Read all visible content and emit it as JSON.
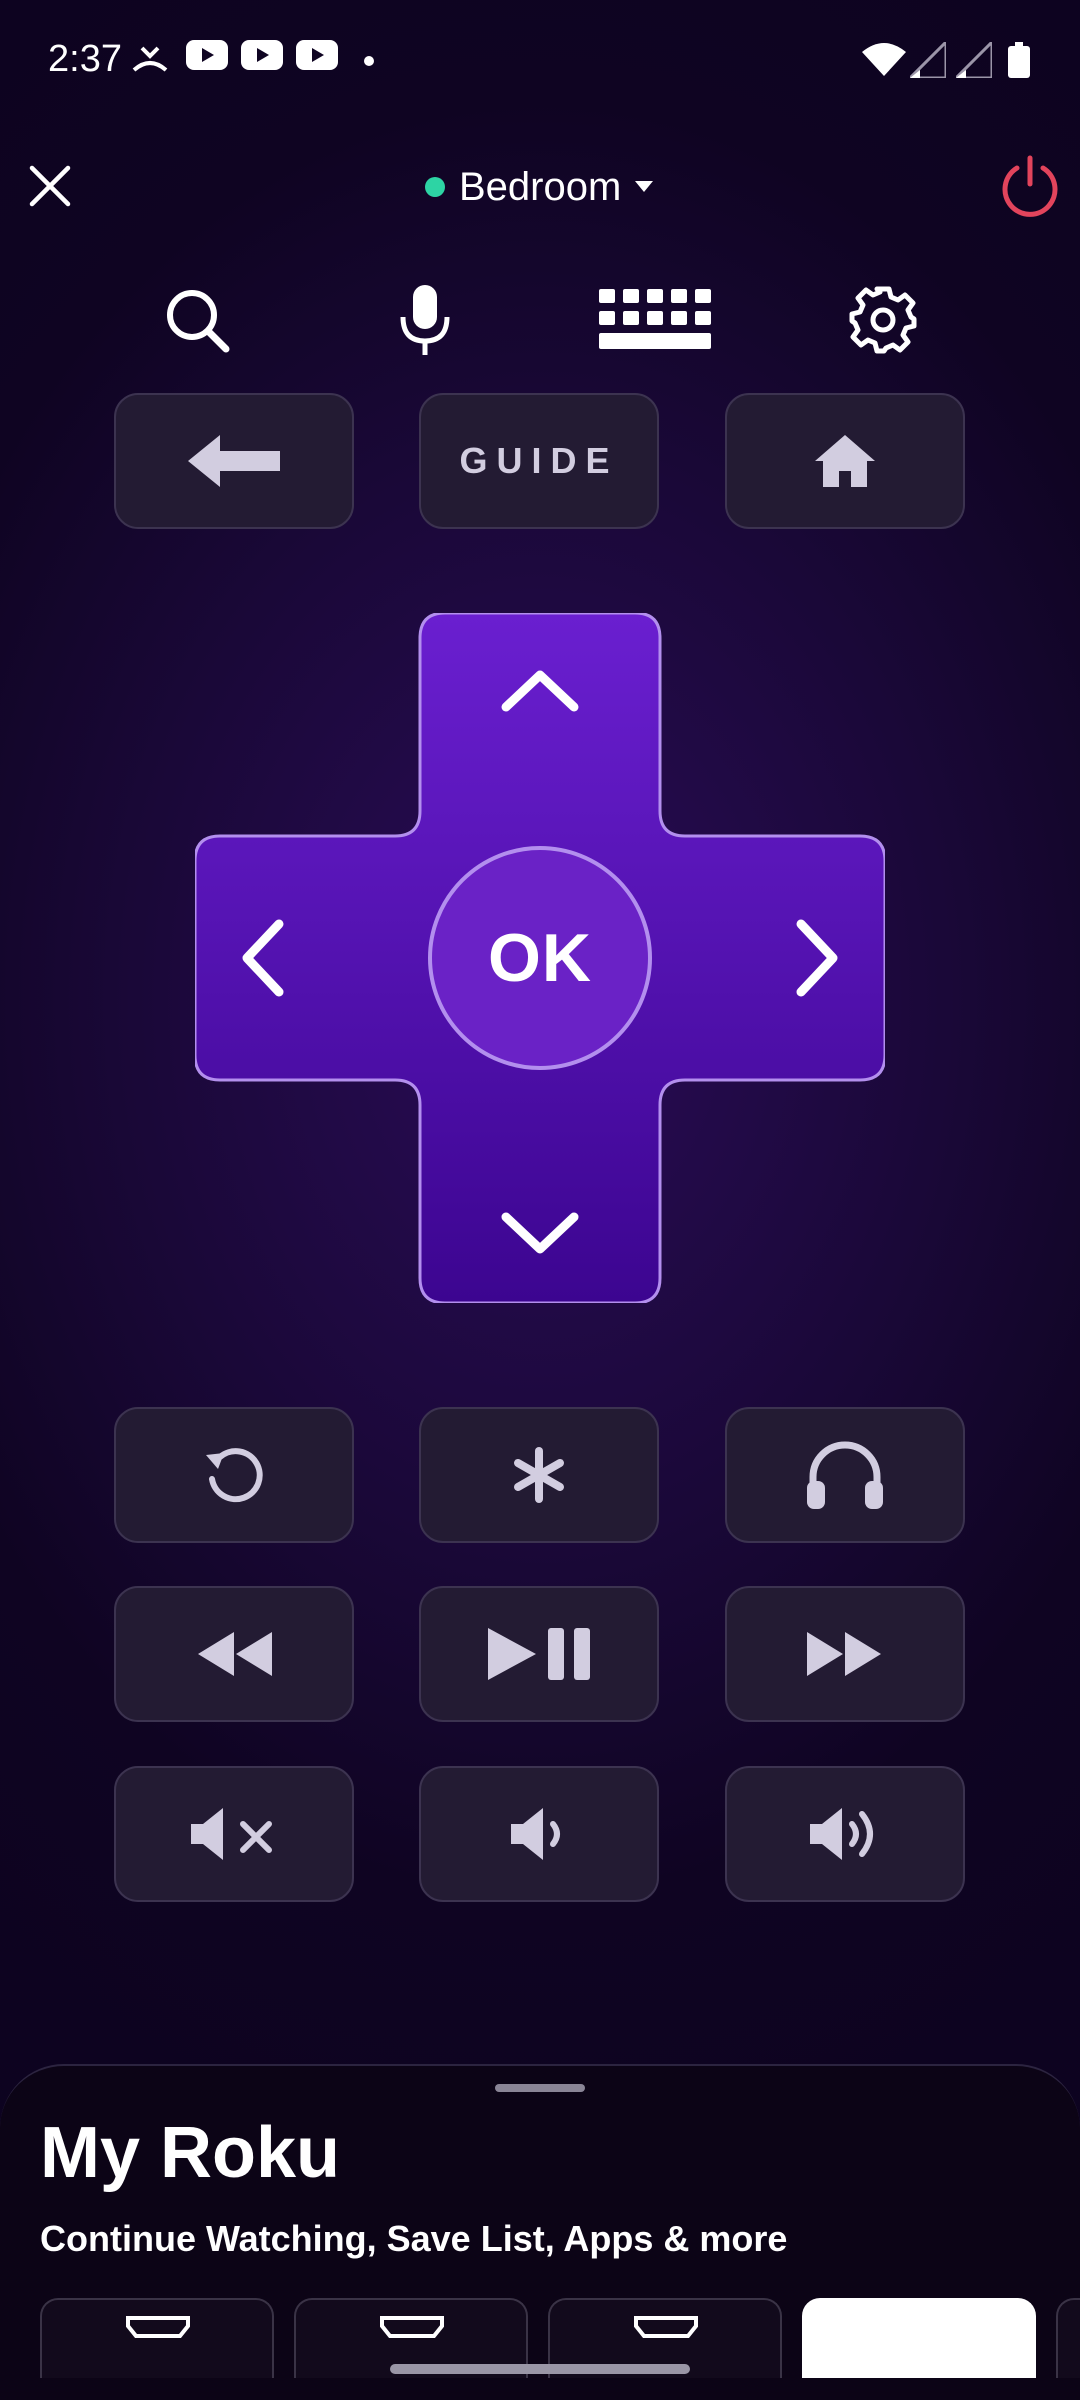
{
  "status_bar": {
    "time": "2:37",
    "left_icons": [
      "missed-call-icon",
      "youtube-icon",
      "youtube-icon",
      "youtube-icon",
      "dot-icon"
    ],
    "right_icons": [
      "wifi-icon",
      "signal-icon",
      "signal-icon",
      "battery-icon"
    ]
  },
  "top_bar": {
    "device_name": "Bedroom",
    "device_status_color": "#2dd4a4",
    "power_color": "#e2445c"
  },
  "tools": [
    "search-icon",
    "microphone-icon",
    "keyboard-icon",
    "settings-icon"
  ],
  "nav_buttons": {
    "guide_label": "GUIDE"
  },
  "dpad": {
    "ok_label": "OK",
    "accent": "#5b13b8"
  },
  "bottom_sheet": {
    "title": "My Roku",
    "subtitle": "Continue Watching, Save List, Apps & more"
  }
}
